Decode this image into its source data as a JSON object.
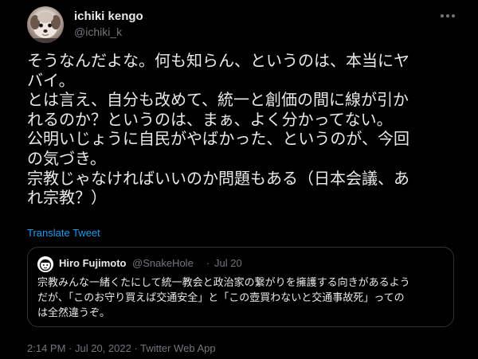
{
  "author": {
    "display_name": "ichiki kengo",
    "handle": "@ichiki_k"
  },
  "more_icon": "more-horizontal-icon",
  "tweet_lines": [
    "そうなんだよな。何も知らん、というのは、本当にヤ",
    "バイ。",
    "とは言え、自分も改めて、統一と創価の間に線が引か",
    "れるのか？というのは、まぁ、よく分かってない。",
    "公明いじょうに自民がやばかった、というのが、今回",
    "の気づき。",
    "宗教じゃなければいいのか問題もある（日本会議、あ",
    "れ宗教？）"
  ],
  "translate_label": "Translate Tweet",
  "quote": {
    "display_name": "Hiro Fujimoto",
    "handle": "@SnakeHole",
    "separator": "·",
    "date": "Jul 20",
    "lines": [
      "宗教みんな一緒くたにして統一教会と政治家の繋がりを擁護する向きがあるよう",
      "だが、「このお守り買えば交通安全」と「この壺買わないと交通事故死」っての",
      "は全然違うぞ。"
    ]
  },
  "meta": {
    "time": "2:14 PM",
    "dot1": " · ",
    "date": "Jul 20, 2022",
    "dot2": " · ",
    "source": "Twitter Web App"
  },
  "colors": {
    "background": "#000000",
    "text": "#e7e9ea",
    "muted": "#71767b",
    "link": "#1d9bf0",
    "border": "#2f3336"
  }
}
